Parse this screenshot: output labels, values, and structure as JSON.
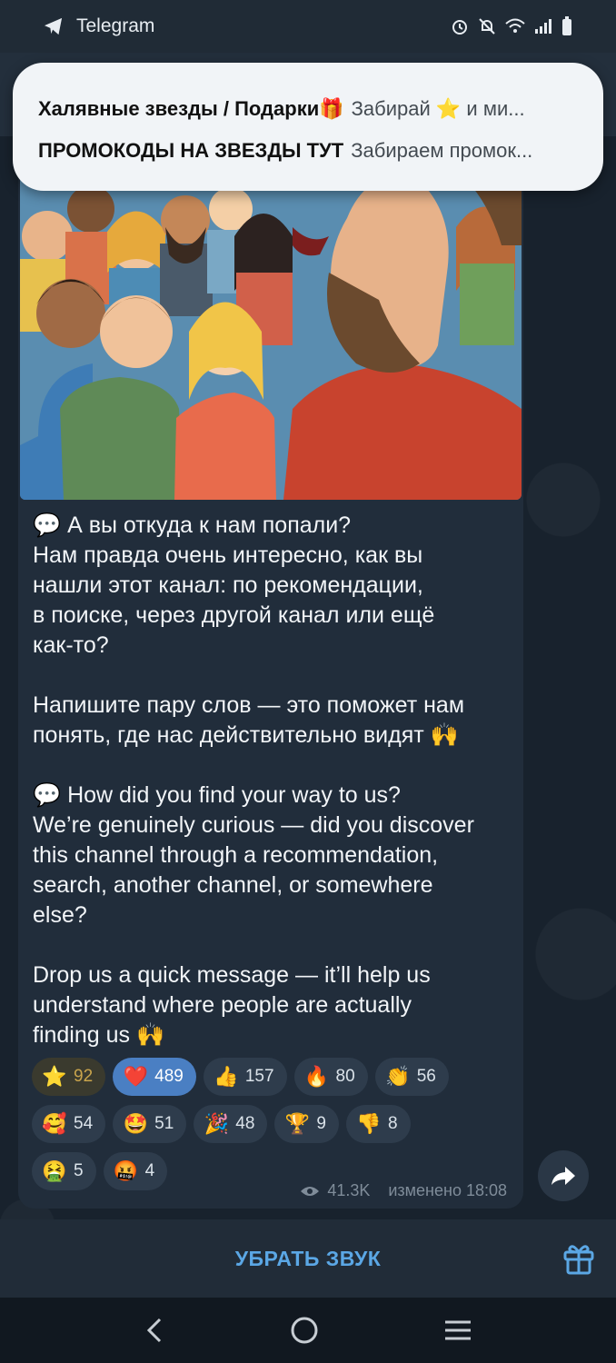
{
  "status_bar": {
    "app_name": "Telegram",
    "icons": [
      "alarm-icon",
      "mute-icon",
      "wifi-icon",
      "signal-icon",
      "battery-icon"
    ]
  },
  "notification": {
    "rows": [
      {
        "title": "Халявные звезды / Подарки🎁",
        "text": "Забирай ⭐ и ми..."
      },
      {
        "title": "ПРОМОКОДЫ НА ЗВЕЗДЫ ТУТ",
        "text": "Забираем промок..."
      }
    ]
  },
  "message": {
    "paragraphs": [
      [
        "💬 А вы откуда к нам попали?",
        "Нам правда очень интересно, как вы",
        "нашли этот канал: по рекомендации,",
        "в поиске, через другой канал или ещё",
        "как-то?"
      ],
      [
        "Напишите пару слов — это поможет нам",
        "понять, где нас действительно видят 🙌"
      ],
      [
        "💬 How did you find your way to us?",
        "We’re genuinely curious — did you discover",
        "this channel through a recommendation,",
        "search, another channel, or somewhere",
        "else?"
      ],
      [
        "Drop us a quick message — it’ll help us",
        "understand where people are actually",
        "finding us 🙌"
      ]
    ],
    "reactions": [
      [
        {
          "icon": "⭐",
          "count": "92",
          "kind": "star"
        },
        {
          "icon": "❤️",
          "count": "489",
          "kind": "heart"
        },
        {
          "icon": "👍",
          "count": "157"
        },
        {
          "icon": "🔥",
          "count": "80"
        },
        {
          "icon": "👏",
          "count": "56"
        }
      ],
      [
        {
          "icon": "🥰",
          "count": "54"
        },
        {
          "icon": "🤩",
          "count": "51"
        },
        {
          "icon": "🎉",
          "count": "48"
        },
        {
          "icon": "🏆",
          "count": "9"
        },
        {
          "icon": "👎",
          "count": "8"
        }
      ],
      [
        {
          "icon": "🤮",
          "count": "5"
        },
        {
          "icon": "🤬",
          "count": "4"
        }
      ]
    ],
    "views": "41.3K",
    "edited_time": "изменено 18:08"
  },
  "bottom": {
    "mute_label": "УБРАТЬ ЗВУК"
  },
  "colors": {
    "accent": "#5ba7e5",
    "bubble": "#212d3b",
    "heart_chip": "#4a7fc3"
  }
}
